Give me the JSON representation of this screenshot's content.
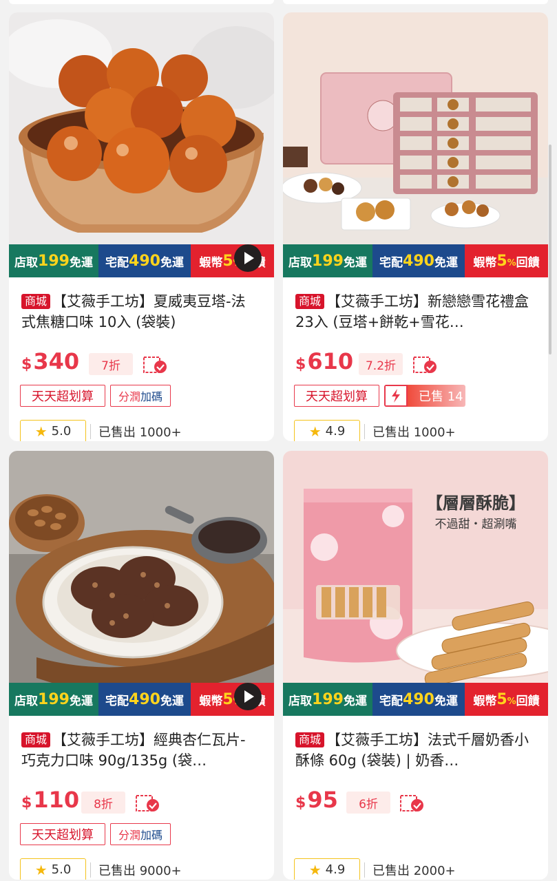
{
  "banner": {
    "pickup": "店取",
    "pickup_amt": "199",
    "pickup_suffix": "免運",
    "delivery": "宅配",
    "delivery_amt": "490",
    "delivery_suffix": "免運",
    "coins": "蝦幣",
    "coins_amt": "5%",
    "coins_suffix": "回饋"
  },
  "products": [
    {
      "badge": "商城",
      "title": "【艾薇手工坊】夏威夷豆塔-法式焦糖口味 10入 (袋裝)",
      "currency": "$",
      "price": "340",
      "discount": "7折",
      "tags": [
        "天天超划算",
        "分潤加碼"
      ],
      "rating": "5.0",
      "sold": "已售出 1000+",
      "has_video": true
    },
    {
      "badge": "商城",
      "title": "【艾薇手工坊】新戀戀雪花禮盒 23入 (豆塔+餅乾+雪花…",
      "currency": "$",
      "price": "610",
      "discount": "7.2折",
      "tags": [
        "天天超划算"
      ],
      "flash_sale": "已售 14",
      "rating": "4.9",
      "sold": "已售出 1000+",
      "has_video": false
    },
    {
      "badge": "商城",
      "title": "【艾薇手工坊】經典杏仁瓦片-巧克力口味 90g/135g (袋…",
      "currency": "$",
      "price": "110",
      "discount": "8折",
      "tags": [
        "天天超划算",
        "分潤加碼"
      ],
      "rating": "5.0",
      "sold": "已售出 9000+",
      "has_video": true
    },
    {
      "badge": "商城",
      "title": "【艾薇手工坊】法式千層奶香小酥條 60g (袋裝) | 奶香…",
      "currency": "$",
      "price": "95",
      "discount": "6折",
      "tags": [],
      "rating": "4.9",
      "sold": "已售出 2000+",
      "has_video": false,
      "image_text": "【層層酥脆】",
      "image_subtext": "不過甜・超涮嘴"
    }
  ],
  "colors": {
    "accent": "#e8374a",
    "mall_badge": "#d7142b",
    "banner_green": "#17785f",
    "banner_blue": "#1d4a8c",
    "banner_red": "#e3222e",
    "star": "#f5b80d"
  }
}
